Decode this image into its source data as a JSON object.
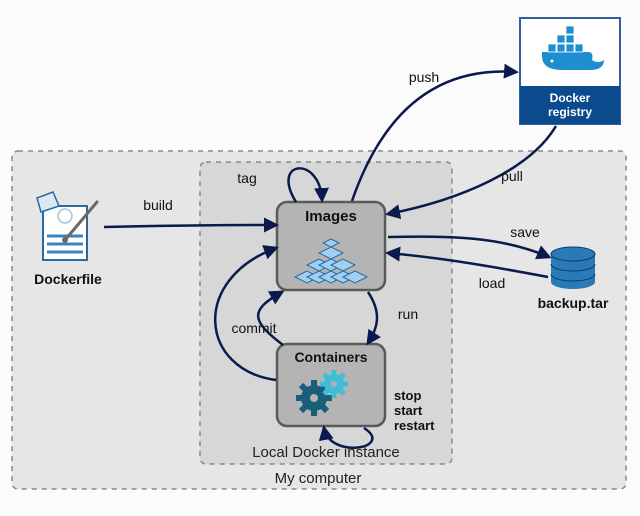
{
  "diagram": {
    "outer_label": "My computer",
    "inner_label": "Local Docker instance",
    "nodes": {
      "dockerfile": {
        "label": "Dockerfile"
      },
      "images": {
        "label": "Images"
      },
      "containers": {
        "label": "Containers"
      },
      "registry": {
        "label1": "Docker",
        "label2": "registry"
      },
      "backup": {
        "label": "backup.tar"
      }
    },
    "edges": {
      "build": "build",
      "tag": "tag",
      "push": "push",
      "pull": "pull",
      "save": "save",
      "load": "load",
      "run": "run",
      "commit": "commit",
      "stop": "stop",
      "start": "start",
      "restart": "restart"
    },
    "colors": {
      "arrow": "#0a1a4c",
      "box_fill": "#b4b4b4",
      "box_stroke": "#5a5a5a",
      "dash_fill": "#e6e6e6",
      "dash_stroke": "#888888",
      "cube": "#9fd0f0",
      "cube_stroke": "#2a6aa0",
      "gear1": "#1a5e7a",
      "gear2": "#3fbfd6",
      "db": "#2a7ab8",
      "registry_bg": "#0b4a8c",
      "registry_border": "#3060a0",
      "paper_stroke": "#2a6aa0",
      "paper_fill": "#ffffff",
      "paper_lines": "#3b83c0",
      "ruler": "#d9e9f5"
    }
  }
}
